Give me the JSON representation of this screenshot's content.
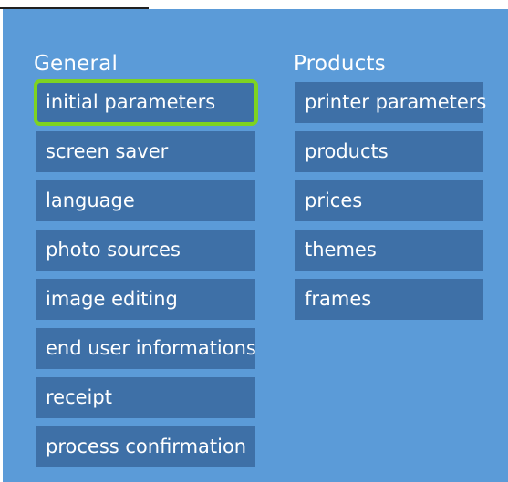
{
  "general": {
    "title": "General",
    "items": [
      {
        "label": "initial parameters",
        "selected": true
      },
      {
        "label": "screen saver"
      },
      {
        "label": "language"
      },
      {
        "label": "photo sources"
      },
      {
        "label": "image editing"
      },
      {
        "label": "end user informations"
      },
      {
        "label": "receipt"
      },
      {
        "label": "process confirmation"
      }
    ]
  },
  "products": {
    "title": "Products",
    "items": [
      {
        "label": "printer parameters"
      },
      {
        "label": "products"
      },
      {
        "label": "prices"
      },
      {
        "label": "themes"
      },
      {
        "label": "frames"
      }
    ]
  },
  "colors": {
    "panel_bg": "#5b9bd8",
    "tile_bg": "#3e70a7",
    "selection": "#7ed321",
    "text": "#ffffff"
  }
}
